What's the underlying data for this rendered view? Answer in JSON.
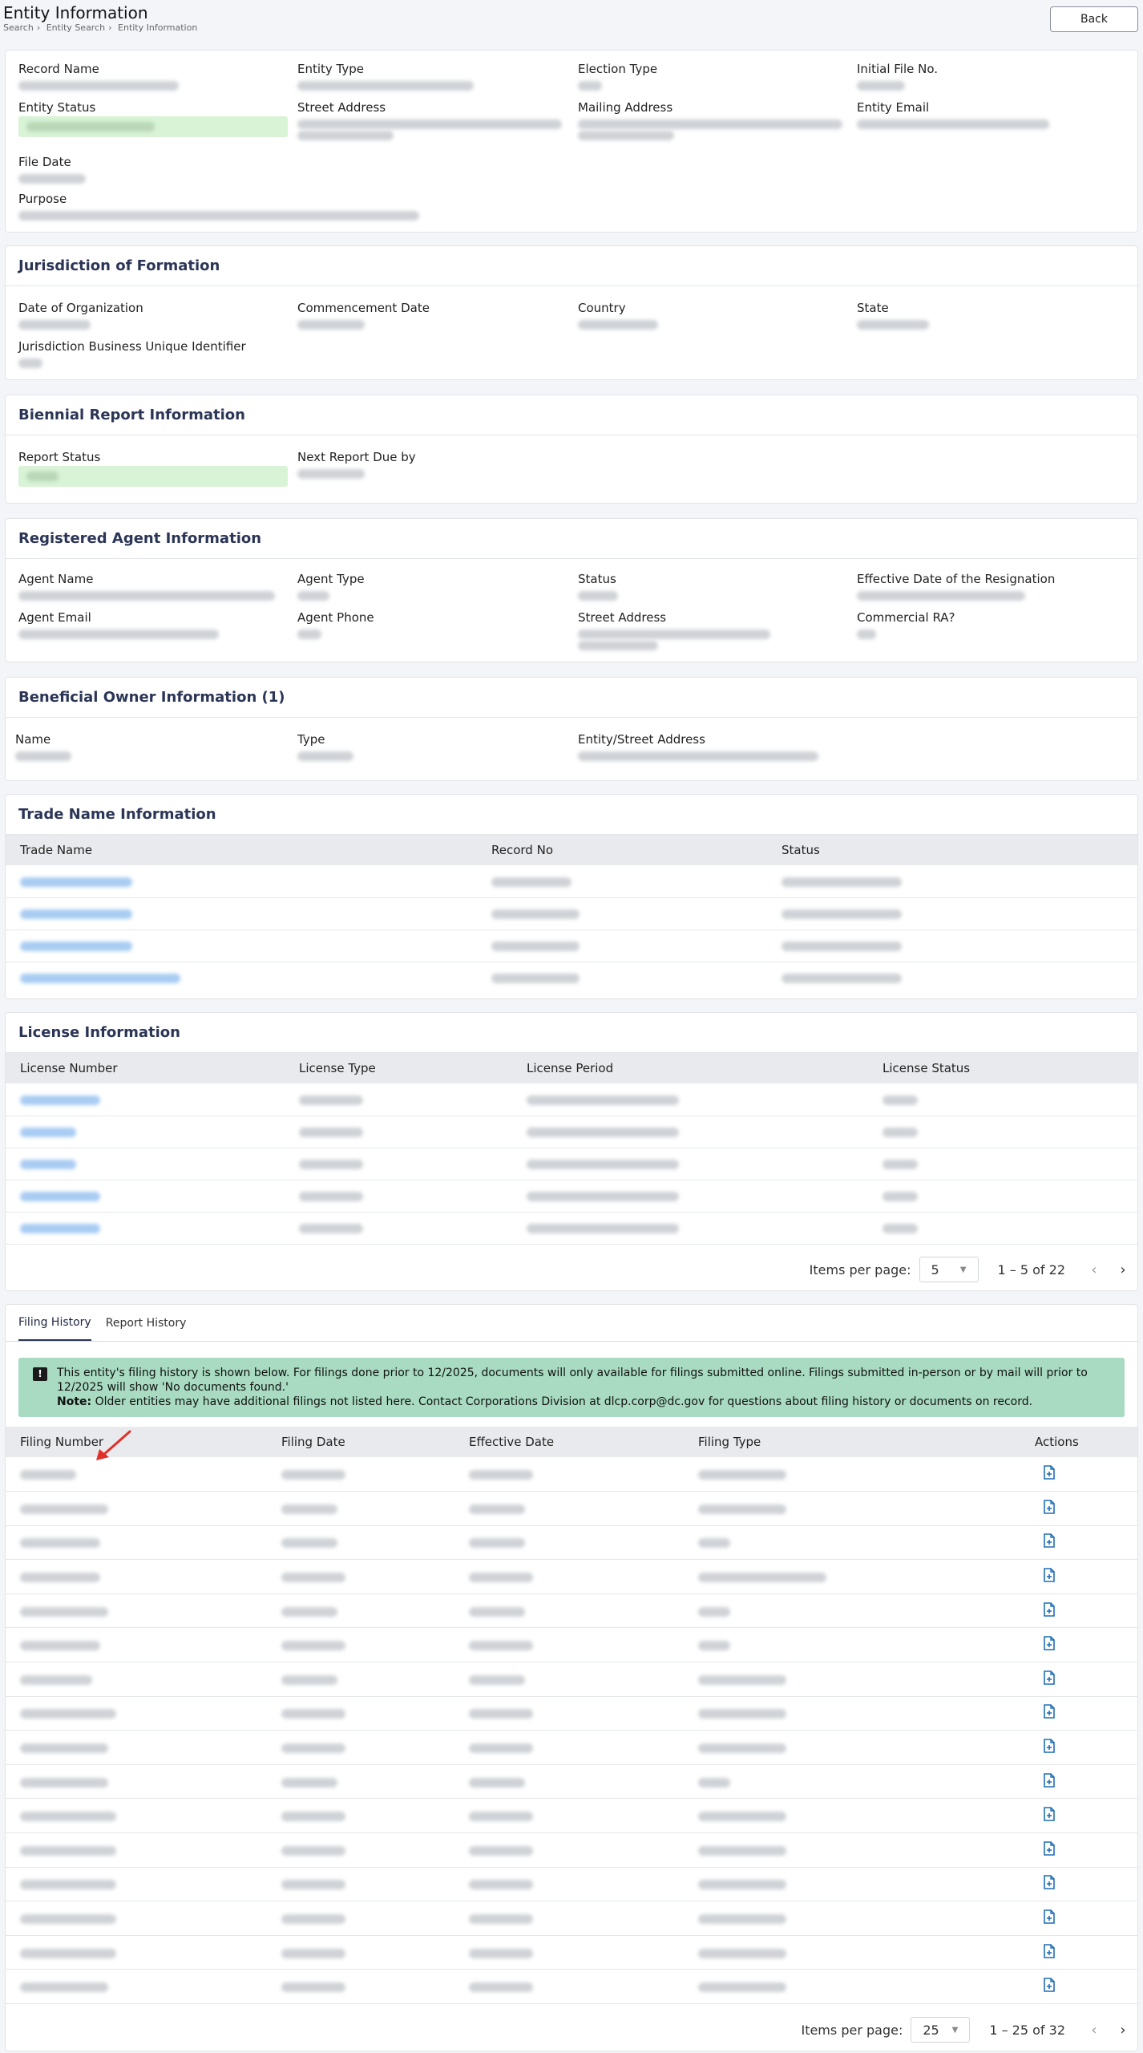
{
  "header": {
    "title": "Entity Information",
    "breadcrumb": [
      "Search",
      "Entity Search",
      "Entity Information"
    ],
    "breadcrumb_sep": "›",
    "back_label": "Back"
  },
  "entity": {
    "labels": {
      "record_name": "Record Name",
      "entity_type": "Entity Type",
      "election_type": "Election Type",
      "initial_file_no": "Initial File No.",
      "entity_status": "Entity Status",
      "street_address": "Street Address",
      "mailing_address": "Mailing Address",
      "entity_email": "Entity Email",
      "file_date": "File Date",
      "purpose": "Purpose"
    }
  },
  "jurisdiction": {
    "title": "Jurisdiction of Formation",
    "labels": {
      "date_of_organization": "Date of Organization",
      "commencement_date": "Commencement Date",
      "country": "Country",
      "state": "State",
      "business_uid": "Jurisdiction Business Unique Identifier"
    }
  },
  "biennial": {
    "title": "Biennial Report Information",
    "labels": {
      "report_status": "Report Status",
      "next_report_due": "Next Report Due by"
    }
  },
  "agent": {
    "title": "Registered Agent Information",
    "labels": {
      "agent_name": "Agent Name",
      "agent_type": "Agent Type",
      "status": "Status",
      "resignation_date": "Effective Date of the Resignation",
      "agent_email": "Agent Email",
      "agent_phone": "Agent Phone",
      "street_address": "Street Address",
      "commercial_ra": "Commercial RA?"
    }
  },
  "beneficial": {
    "title": "Beneficial Owner Information (1)",
    "labels": {
      "name": "Name",
      "type": "Type",
      "address": "Entity/Street Address"
    }
  },
  "trade_names": {
    "title": "Trade Name Information",
    "columns": [
      "Trade Name",
      "Record No",
      "Status"
    ]
  },
  "licenses": {
    "title": "License Information",
    "columns": [
      "License Number",
      "License Type",
      "License Period",
      "License Status"
    ],
    "items_per_page_label": "Items per page:",
    "items_per_page": "5",
    "range": "1 – 5 of 22"
  },
  "history": {
    "tabs": [
      "Filing History",
      "Report History"
    ],
    "notice_icon": "!",
    "notice_text": "This entity's filing history is shown below. For filings done prior to 12/2025, documents will only available for filings submitted online. Filings submitted in-person or by mail will prior to 12/2025 will show 'No documents found.'",
    "note_label": "Note:",
    "note_text": "Older entities may have additional filings not listed here. Contact Corporations Division at dlcp.corp@dc.gov for questions about filing history or documents on record.",
    "columns": [
      "Filing Number",
      "Filing Date",
      "Effective Date",
      "Filing Type",
      "Actions"
    ],
    "items_per_page_label": "Items per page:",
    "items_per_page": "25",
    "range": "1 – 25 of 32"
  },
  "icons": {
    "document": "document-icon",
    "arrow": "red-arrow-annotation",
    "chevron": "chevron-icon"
  },
  "colors": {
    "accent": "#2b3556",
    "notice_bg": "#a8dbc1",
    "status_green": "#d8f3d6",
    "action_icon": "#1f6fb5",
    "arrow": "#e0302a"
  }
}
